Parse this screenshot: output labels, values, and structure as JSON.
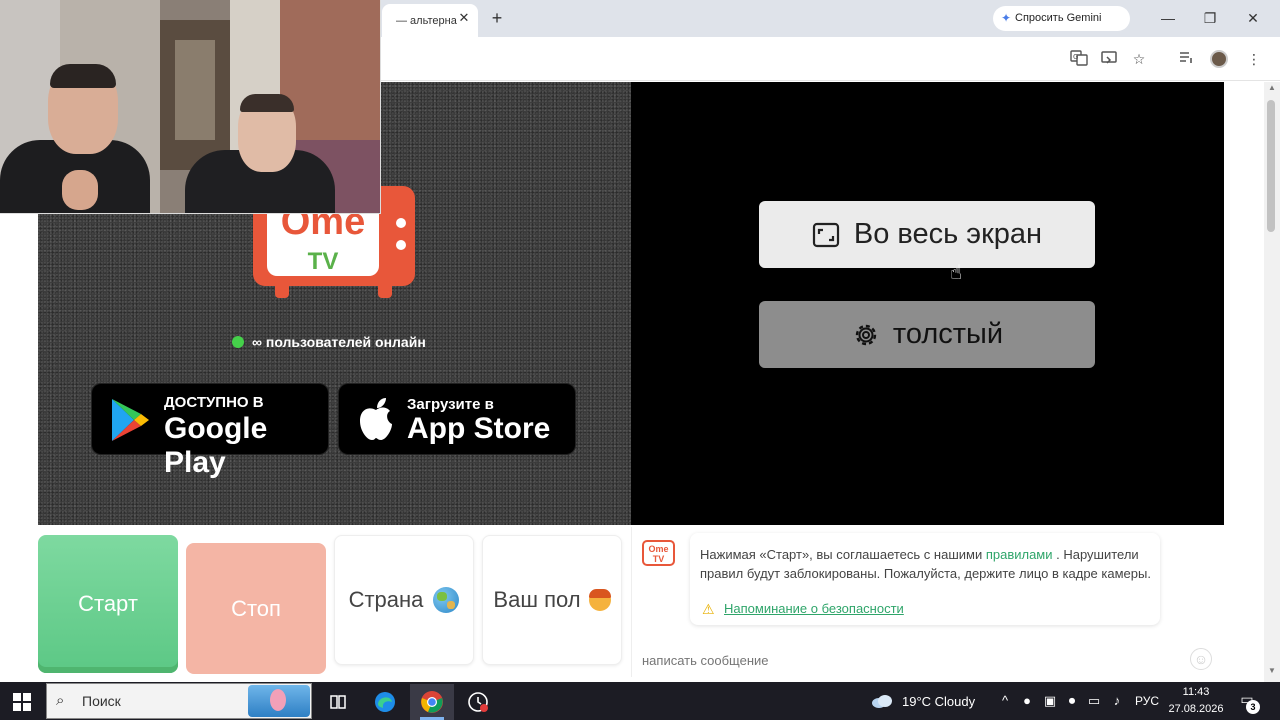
{
  "browser": {
    "tab_title": "— альтерна",
    "tab_close": "✕",
    "new_tab": "+",
    "gemini_label": "Спросить Gemini",
    "window": {
      "minimize": "—",
      "restore": "❐",
      "close": "✕"
    },
    "toolbar_icons": [
      "translate-icon",
      "cast-icon",
      "bookmark-star-icon",
      "reading-list-icon",
      "profile-avatar",
      "menu-icon"
    ]
  },
  "site": {
    "logo": {
      "word1": "Ome",
      "word2": "TV"
    },
    "online_text": "∞ пользователей онлайн",
    "google_play": {
      "small": "ДОСТУПНО В",
      "big": "Google Play"
    },
    "app_store": {
      "small": "Загрузите в",
      "big": "App Store"
    },
    "fullscreen_label": "Во весь экран",
    "settings_label": "толстый",
    "controls": {
      "start": "Старт",
      "stop": "Стоп",
      "country": "Страна",
      "gender": "Ваш пол"
    },
    "chat": {
      "avatar_text": "Ome TV",
      "intro_before": "Нажимая «Старт», вы соглашаетесь с нашими ",
      "rules_link": "правилами",
      "intro_after": " . Нарушители правил будут заблокированы. Пожалуйста, держите лицо в кадре камеры.",
      "safety_link": "Напоминание о безопасности",
      "placeholder": "написать сообщение"
    }
  },
  "taskbar": {
    "search_placeholder": "Поиск",
    "weather": "19°C  Cloudy",
    "language": "РУС",
    "time": "11:43",
    "date": "27.08.2026",
    "notification_count": "3"
  },
  "colors": {
    "brand_orange": "#e8573a",
    "brand_green": "#5ab14a",
    "start_green": "#5cc885",
    "stop_pink": "#f4b5a5",
    "link_green": "#2fa56a"
  }
}
